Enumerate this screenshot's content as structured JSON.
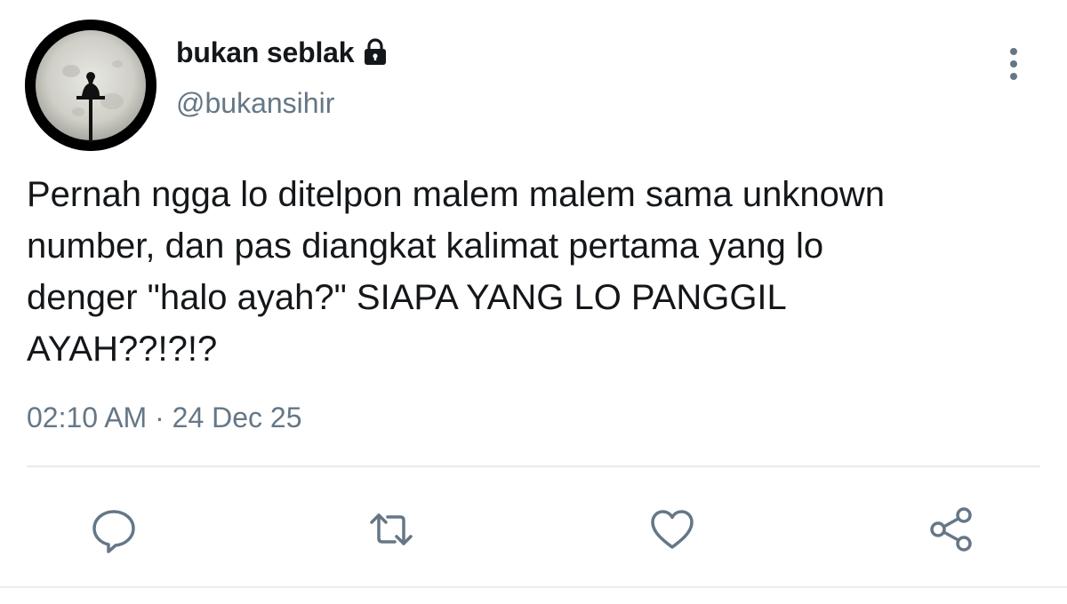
{
  "user": {
    "display_name": "bukan seblak",
    "handle": "@bukansihir",
    "protected": true,
    "avatar": "moon-silhouette-avatar"
  },
  "tweet": {
    "text": "Pernah ngga lo ditelpon malem malem sama unknown\nnumber, dan pas diangkat kalimat pertama yang lo\ndenger \"halo ayah?\" SIAPA YANG LO PANGGIL\nAYAH??!?!?",
    "timestamp": "02:10 AM · 24 Dec 25"
  },
  "actions": {
    "icons": [
      "reply-icon",
      "retweet-icon",
      "like-icon",
      "share-icon"
    ]
  },
  "colors": {
    "text_primary": "#14171a",
    "text_secondary": "#657786",
    "icon_color": "#657786",
    "divider": "#e6ecf0"
  }
}
